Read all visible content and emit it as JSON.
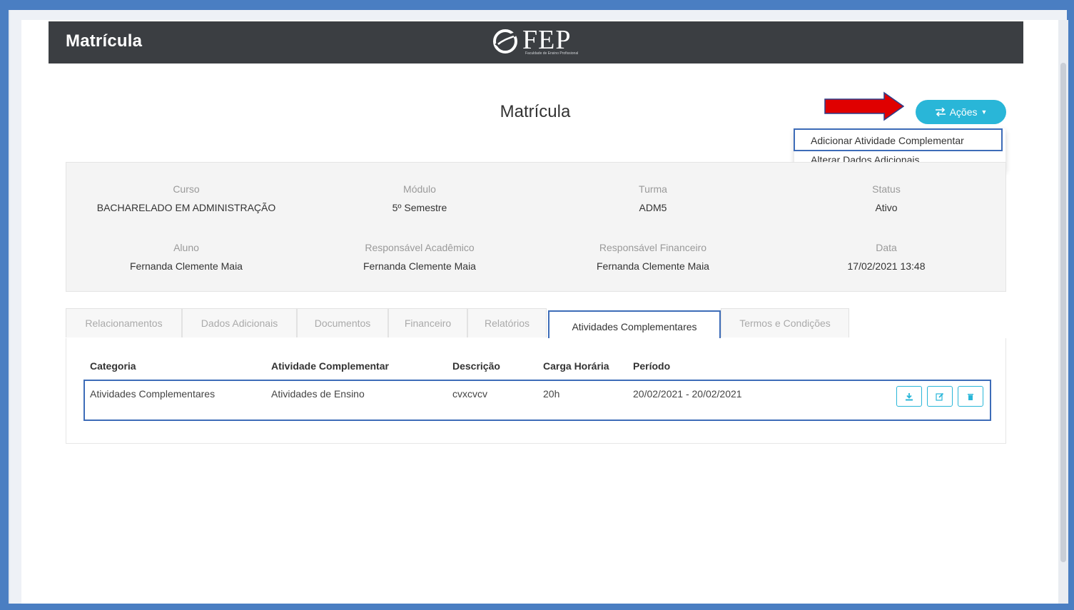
{
  "header": {
    "app_title": "Matrícula",
    "logo_text": "FEP",
    "logo_subtext": "Faculdade de Ensino Profissional"
  },
  "page": {
    "title": "Matrícula"
  },
  "actions": {
    "button_label": "Ações",
    "button_icon": "exchange-arrows-icon",
    "menu": [
      {
        "label": "Adicionar Atividade Complementar"
      },
      {
        "label": "Alterar Dados Adicionais"
      }
    ]
  },
  "info": {
    "curso": {
      "label": "Curso",
      "value": "BACHARELADO EM ADMINISTRAÇÃO"
    },
    "modulo": {
      "label": "Módulo",
      "value": "5º Semestre"
    },
    "turma": {
      "label": "Turma",
      "value": "ADM5"
    },
    "status": {
      "label": "Status",
      "value": "Ativo"
    },
    "aluno": {
      "label": "Aluno",
      "value": "Fernanda Clemente Maia"
    },
    "resp_academico": {
      "label": "Responsável Acadêmico",
      "value": "Fernanda Clemente Maia"
    },
    "resp_financeiro": {
      "label": "Responsável Financeiro",
      "value": "Fernanda Clemente Maia"
    },
    "data": {
      "label": "Data",
      "value": "17/02/2021 13:48"
    }
  },
  "tabs": [
    {
      "label": "Relacionamentos"
    },
    {
      "label": "Dados Adicionais"
    },
    {
      "label": "Documentos"
    },
    {
      "label": "Financeiro"
    },
    {
      "label": "Relatórios"
    },
    {
      "label": "Atividades Complementares",
      "active": true
    },
    {
      "label": "Termos e Condições"
    }
  ],
  "table": {
    "columns": [
      "Categoria",
      "Atividade Complementar",
      "Descrição",
      "Carga Horária",
      "Período"
    ],
    "rows": [
      {
        "categoria": "Atividades Complementares",
        "atividade": "Atividades de Ensino",
        "descricao": "cvxcvcv",
        "carga": "20h",
        "periodo": "20/02/2021 - 20/02/2021"
      }
    ],
    "row_actions": [
      "download-icon",
      "edit-icon",
      "trash-icon"
    ]
  },
  "colors": {
    "accent": "#29b6d8",
    "topbar": "#3b3e42",
    "highlight_border": "#3d6cb8",
    "arrow": "#e00000",
    "frame": "#4a7ec2"
  }
}
